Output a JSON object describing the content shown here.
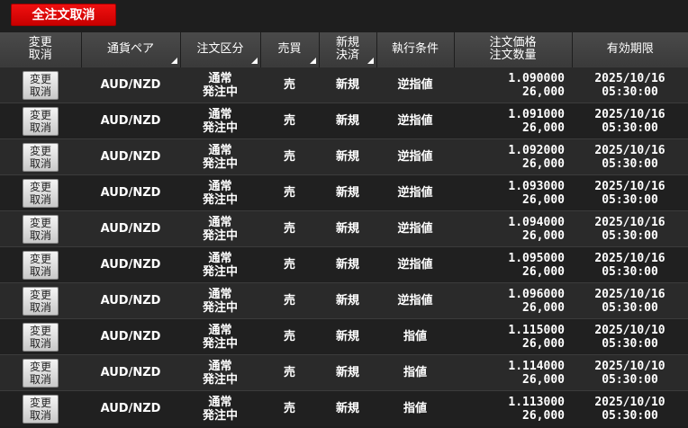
{
  "toolbar": {
    "cancel_all_label": "全注文取消"
  },
  "columns": {
    "modify": [
      "変更",
      "取消"
    ],
    "pair": "通貨ペア",
    "order_type": "注文区分",
    "side": "売買",
    "new_close": [
      "新規",
      "決済"
    ],
    "condition": "執行条件",
    "price_qty": [
      "注文価格",
      "注文数量"
    ],
    "expiry": "有効期限"
  },
  "rows": [
    {
      "btn": [
        "変更",
        "取消"
      ],
      "pair": "AUD/NZD",
      "type": [
        "通常",
        "発注中"
      ],
      "side": "売",
      "nc": "新規",
      "cond": "逆指値",
      "price": "1.090000",
      "qty": "26,000",
      "date": "2025/10/16",
      "time": "05:30:00"
    },
    {
      "btn": [
        "変更",
        "取消"
      ],
      "pair": "AUD/NZD",
      "type": [
        "通常",
        "発注中"
      ],
      "side": "売",
      "nc": "新規",
      "cond": "逆指値",
      "price": "1.091000",
      "qty": "26,000",
      "date": "2025/10/16",
      "time": "05:30:00"
    },
    {
      "btn": [
        "変更",
        "取消"
      ],
      "pair": "AUD/NZD",
      "type": [
        "通常",
        "発注中"
      ],
      "side": "売",
      "nc": "新規",
      "cond": "逆指値",
      "price": "1.092000",
      "qty": "26,000",
      "date": "2025/10/16",
      "time": "05:30:00"
    },
    {
      "btn": [
        "変更",
        "取消"
      ],
      "pair": "AUD/NZD",
      "type": [
        "通常",
        "発注中"
      ],
      "side": "売",
      "nc": "新規",
      "cond": "逆指値",
      "price": "1.093000",
      "qty": "26,000",
      "date": "2025/10/16",
      "time": "05:30:00"
    },
    {
      "btn": [
        "変更",
        "取消"
      ],
      "pair": "AUD/NZD",
      "type": [
        "通常",
        "発注中"
      ],
      "side": "売",
      "nc": "新規",
      "cond": "逆指値",
      "price": "1.094000",
      "qty": "26,000",
      "date": "2025/10/16",
      "time": "05:30:00"
    },
    {
      "btn": [
        "変更",
        "取消"
      ],
      "pair": "AUD/NZD",
      "type": [
        "通常",
        "発注中"
      ],
      "side": "売",
      "nc": "新規",
      "cond": "逆指値",
      "price": "1.095000",
      "qty": "26,000",
      "date": "2025/10/16",
      "time": "05:30:00"
    },
    {
      "btn": [
        "変更",
        "取消"
      ],
      "pair": "AUD/NZD",
      "type": [
        "通常",
        "発注中"
      ],
      "side": "売",
      "nc": "新規",
      "cond": "逆指値",
      "price": "1.096000",
      "qty": "26,000",
      "date": "2025/10/16",
      "time": "05:30:00"
    },
    {
      "btn": [
        "変更",
        "取消"
      ],
      "pair": "AUD/NZD",
      "type": [
        "通常",
        "発注中"
      ],
      "side": "売",
      "nc": "新規",
      "cond": "指値",
      "price": "1.115000",
      "qty": "26,000",
      "date": "2025/10/10",
      "time": "05:30:00"
    },
    {
      "btn": [
        "変更",
        "取消"
      ],
      "pair": "AUD/NZD",
      "type": [
        "通常",
        "発注中"
      ],
      "side": "売",
      "nc": "新規",
      "cond": "指値",
      "price": "1.114000",
      "qty": "26,000",
      "date": "2025/10/10",
      "time": "05:30:00"
    },
    {
      "btn": [
        "変更",
        "取消"
      ],
      "pair": "AUD/NZD",
      "type": [
        "通常",
        "発注中"
      ],
      "side": "売",
      "nc": "新規",
      "cond": "指値",
      "price": "1.113000",
      "qty": "26,000",
      "date": "2025/10/10",
      "time": "05:30:00"
    }
  ],
  "colors": {
    "sell": "#3aa0e8",
    "cancel_all_bg": "#e00000",
    "header_bg": "#444444"
  }
}
